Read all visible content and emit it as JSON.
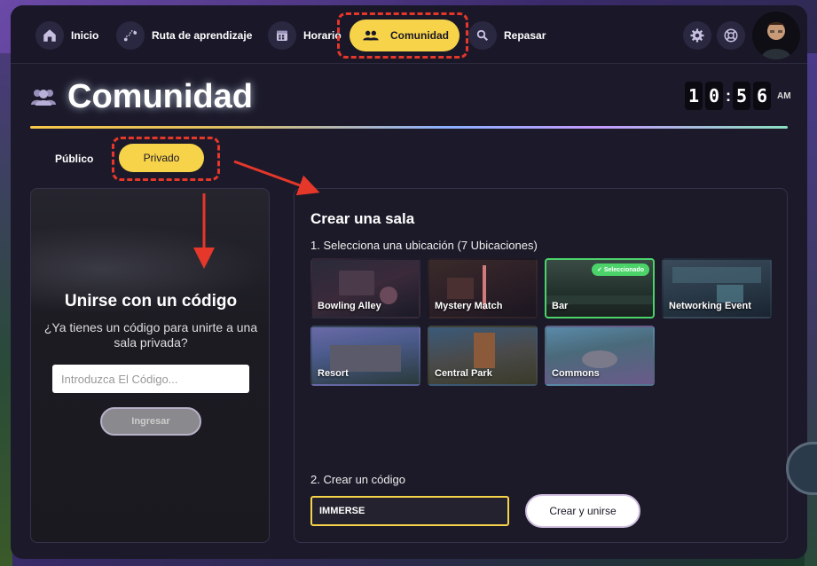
{
  "nav": {
    "items": [
      {
        "label": "Inicio",
        "icon": "home-icon"
      },
      {
        "label": "Ruta de aprendizaje",
        "icon": "route-icon"
      },
      {
        "label": "Horario",
        "icon": "calendar-icon"
      },
      {
        "label": "Comunidad",
        "icon": "people-icon",
        "active": true
      },
      {
        "label": "Repasar",
        "icon": "search-icon"
      }
    ],
    "right_icons": [
      "gear-icon",
      "support-icon",
      "avatar"
    ]
  },
  "page": {
    "title": "Comunidad",
    "title_icon": "people-icon"
  },
  "clock": {
    "h": "1",
    "h2": "0",
    "m1": "5",
    "m2": "6",
    "colon": ":",
    "ampm": "AM"
  },
  "tabs": {
    "public": "Público",
    "private": "Privado",
    "active": "private"
  },
  "join": {
    "title": "Unirse con un código",
    "subtitle": "¿Ya tienes un código para unirte a una sala privada?",
    "placeholder": "Introduzca El Código...",
    "button": "Ingresar"
  },
  "create": {
    "title": "Crear una sala",
    "step1": "1. Selecciona una ubicación (7 Ubicaciones)",
    "locations": [
      {
        "name": "Bowling Alley"
      },
      {
        "name": "Mystery Match"
      },
      {
        "name": "Bar",
        "selected": true,
        "badge": "Seleccionado"
      },
      {
        "name": "Networking Event"
      },
      {
        "name": "Resort"
      },
      {
        "name": "Central Park"
      },
      {
        "name": "Commons"
      }
    ],
    "step2": "2. Crear un código",
    "code_value": "IMMERSE",
    "button": "Crear y unirse"
  },
  "colors": {
    "accent": "#f7d34a",
    "annotation": "#e5372a",
    "selected": "#4bd36a"
  }
}
